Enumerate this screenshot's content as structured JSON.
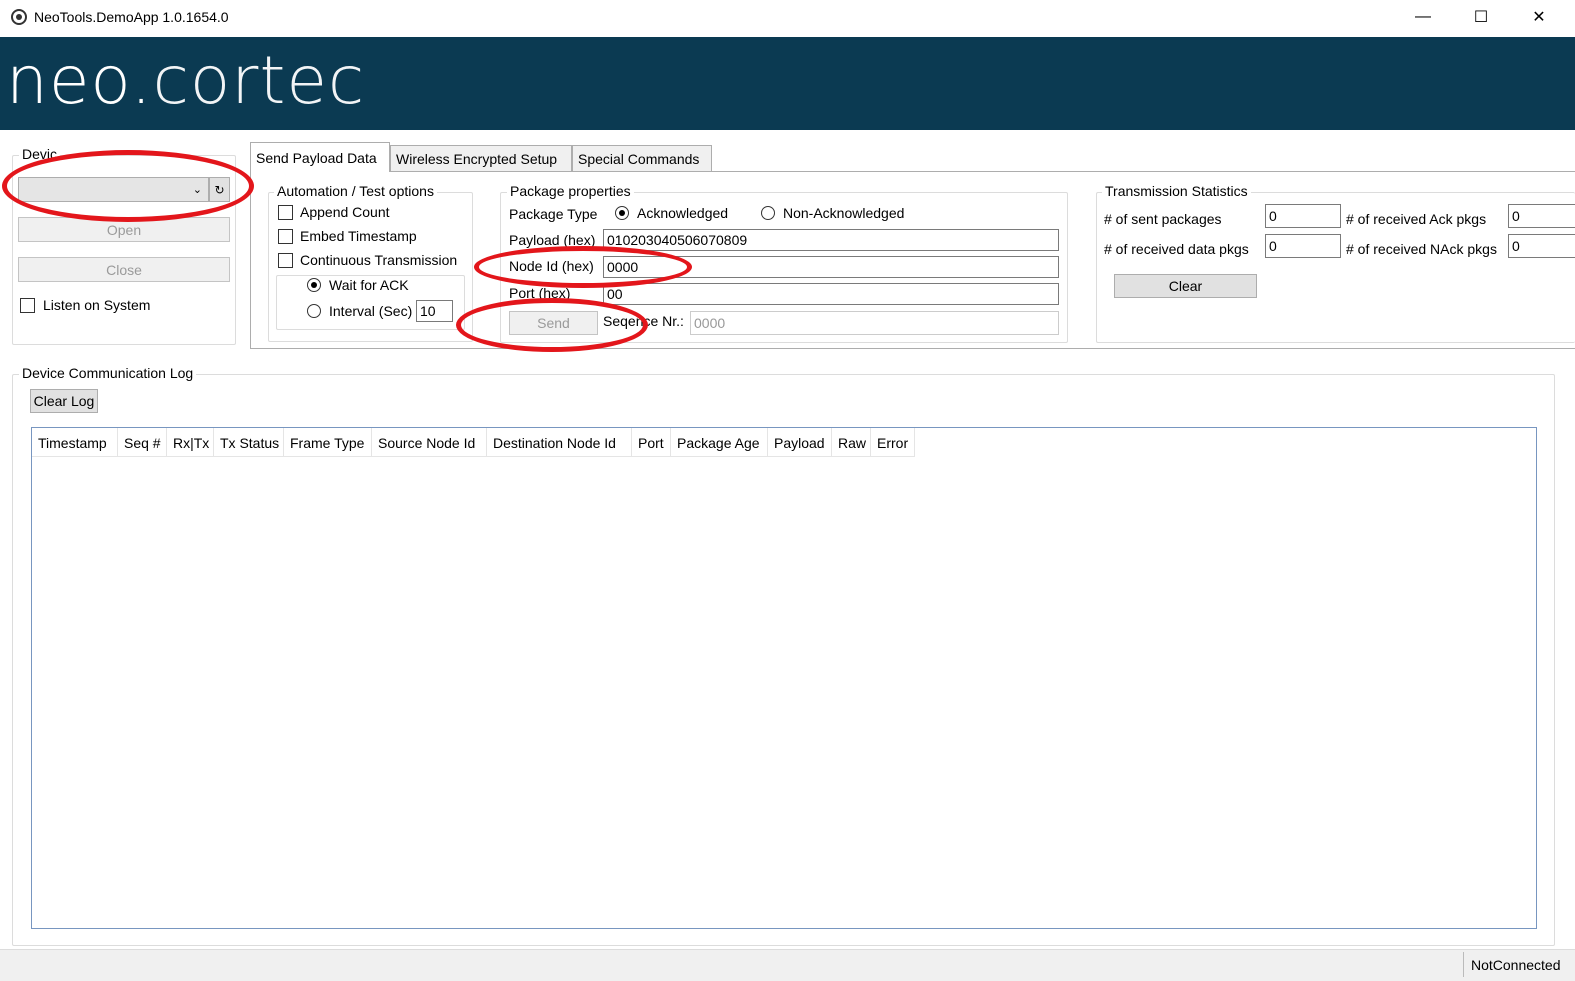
{
  "window": {
    "title": "NeoTools.DemoApp 1.0.1654.0",
    "minimize_glyph": "—",
    "maximize_glyph": "☐",
    "close_glyph": "✕"
  },
  "banner": {
    "logo_part1": "neo.",
    "logo_part2": "cortec",
    "background": "#0b3a52"
  },
  "device": {
    "group_title": "Devic",
    "selected_value": "",
    "refresh_glyph": "↻",
    "open_label": "Open",
    "close_label": "Close",
    "listen_label": "Listen on System"
  },
  "tabs": [
    {
      "label": "Send Payload Data"
    },
    {
      "label": "Wireless Encrypted Setup"
    },
    {
      "label": "Special Commands"
    }
  ],
  "automation": {
    "title": "Automation / Test options",
    "append_count": "Append Count",
    "embed_timestamp": "Embed Timestamp",
    "continuous_transmission": "Continuous Transmission",
    "wait_for_ack": "Wait for ACK",
    "interval_label": "Interval (Sec)",
    "interval_value": "10"
  },
  "package": {
    "title": "Package properties",
    "type_label": "Package Type",
    "acknowledged": "Acknowledged",
    "non_acknowledged": "Non-Acknowledged",
    "payload_label": "Payload (hex)",
    "payload_value": "010203040506070809",
    "node_id_label": "Node Id (hex)",
    "node_id_value": "0000",
    "port_label": "Port (hex)",
    "port_value": "00",
    "send_label": "Send",
    "sequence_label": "Seqence Nr.:",
    "sequence_value": "0000"
  },
  "stats": {
    "title": "Transmission Statistics",
    "sent_label": "# of sent packages",
    "sent_value": "0",
    "recv_data_label": "# of received data pkgs",
    "recv_data_value": "0",
    "recv_ack_label": "# of received Ack pkgs",
    "recv_ack_value": "0",
    "recv_nack_label": "# of received NAck pkgs",
    "recv_nack_value": "0",
    "clear_label": "Clear"
  },
  "log": {
    "title": "Device Communication Log",
    "clear_label": "Clear Log",
    "columns": [
      "Timestamp",
      "Seq #",
      "Rx|Tx",
      "Tx Status",
      "Frame Type",
      "Source Node Id",
      "Destination Node Id",
      "Port",
      "Package Age",
      "Payload",
      "Raw",
      "Error"
    ]
  },
  "status": {
    "connection": "NotConnected"
  },
  "colors": {
    "annotation": "#e3161b",
    "table_border": "#7896c0"
  }
}
